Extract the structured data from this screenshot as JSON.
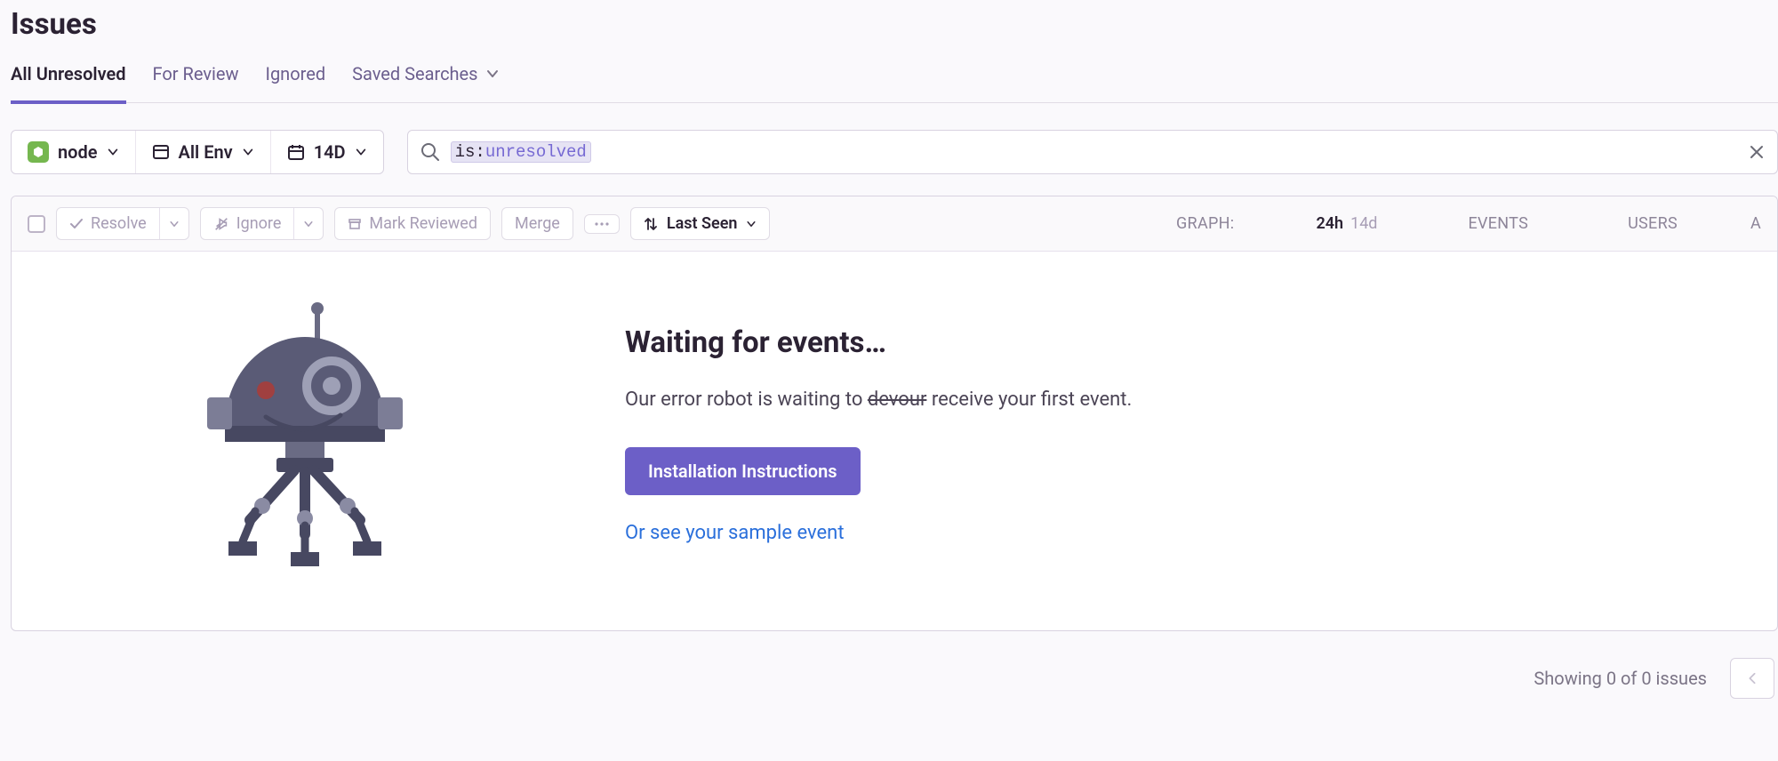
{
  "header": {
    "title": "Issues"
  },
  "tabs": {
    "all_unresolved": "All Unresolved",
    "for_review": "For Review",
    "ignored": "Ignored",
    "saved_searches": "Saved Searches"
  },
  "filters": {
    "project": "node",
    "env": "All Env",
    "period": "14D",
    "search_key": "is:",
    "search_val": "unresolved"
  },
  "toolbar": {
    "resolve": "Resolve",
    "ignore": "Ignore",
    "mark_reviewed": "Mark Reviewed",
    "merge": "Merge",
    "sort": "Last Seen",
    "graph_label": "GRAPH:",
    "time_24h": "24h",
    "time_14d": "14d",
    "events": "EVENTS",
    "users": "USERS",
    "assign": "A"
  },
  "empty": {
    "title": "Waiting for events…",
    "para_pre": "Our error robot is waiting to ",
    "para_strike": "devour",
    "para_post": " receive your first event.",
    "cta": "Installation Instructions",
    "sample": "Or see your sample event"
  },
  "footer": {
    "showing": "Showing 0 of 0 issues"
  }
}
